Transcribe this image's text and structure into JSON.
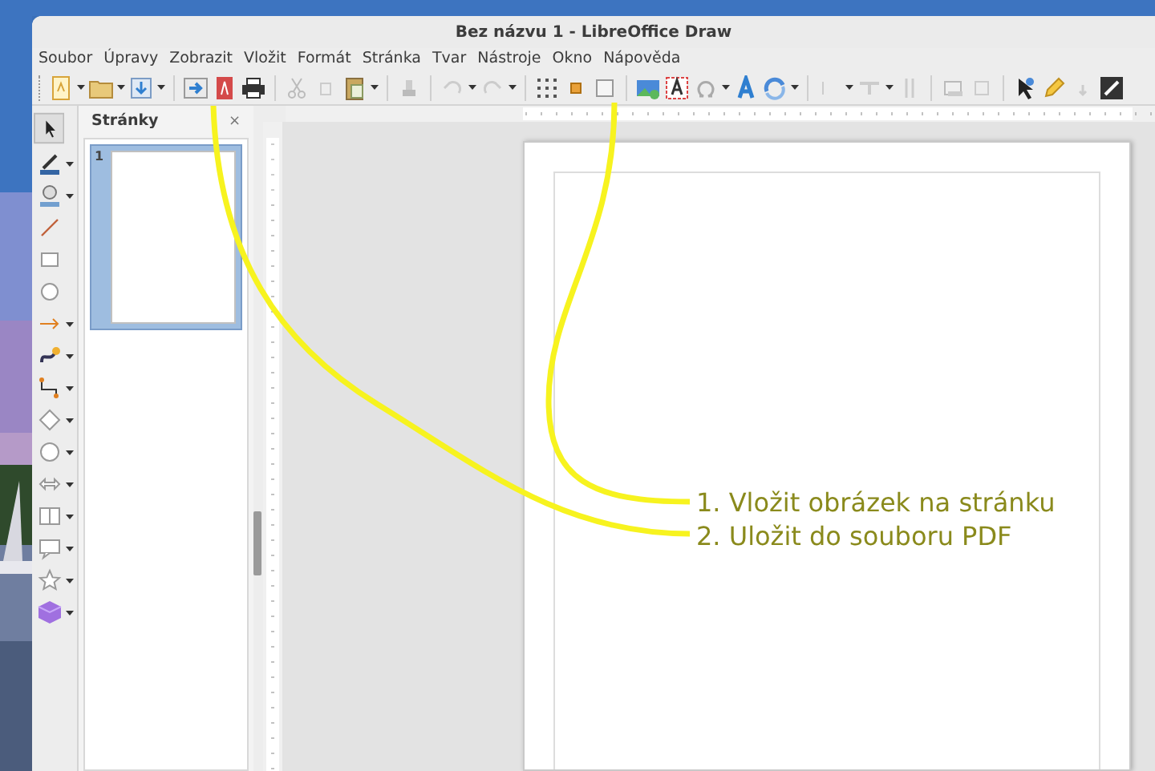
{
  "window": {
    "title": "Bez názvu 1 - LibreOffice Draw"
  },
  "menu": [
    "Soubor",
    "Úpravy",
    "Zobrazit",
    "Vložit",
    "Formát",
    "Stránka",
    "Tvar",
    "Nástroje",
    "Okno",
    "Nápověda"
  ],
  "sidebar": {
    "title": "Stránky",
    "close": "×",
    "pages": [
      {
        "number": "1",
        "selected": true
      }
    ]
  },
  "callouts": [
    {
      "text": "1. Vložit obrázek na stránku"
    },
    {
      "text": "2. Uložit do souboru PDF"
    }
  ]
}
